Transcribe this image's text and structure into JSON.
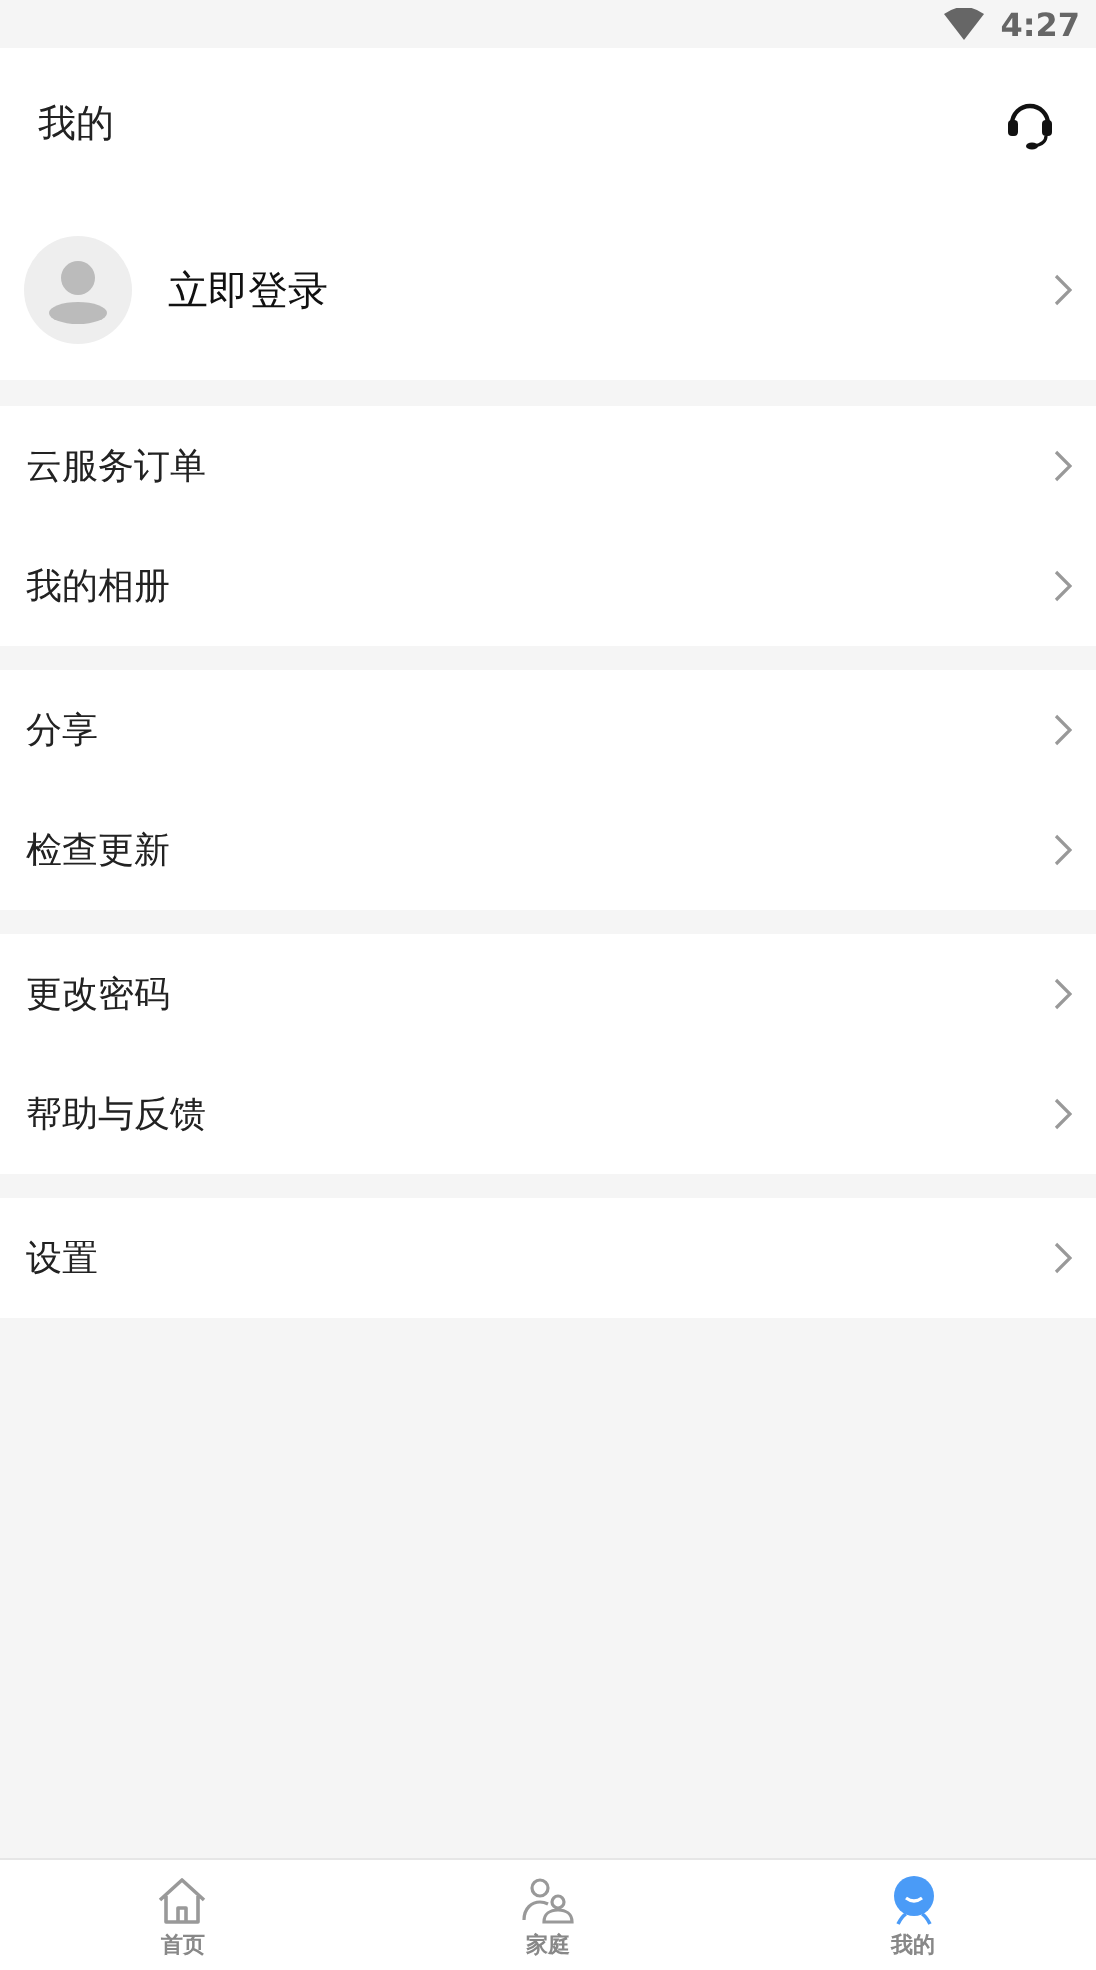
{
  "status_bar": {
    "time": "4:27"
  },
  "header": {
    "title": "我的"
  },
  "login": {
    "label": "立即登录"
  },
  "menu_groups": [
    {
      "items": [
        {
          "label": "云服务订单"
        },
        {
          "label": "我的相册"
        }
      ]
    },
    {
      "items": [
        {
          "label": "分享"
        },
        {
          "label": "检查更新"
        }
      ]
    },
    {
      "items": [
        {
          "label": "更改密码"
        },
        {
          "label": "帮助与反馈"
        }
      ]
    },
    {
      "items": [
        {
          "label": "设置"
        }
      ]
    }
  ],
  "tabs": [
    {
      "kind": "home",
      "label": "首页",
      "selected": false
    },
    {
      "kind": "family",
      "label": "家庭",
      "selected": false
    },
    {
      "kind": "me",
      "label": "我的",
      "selected": true
    }
  ]
}
